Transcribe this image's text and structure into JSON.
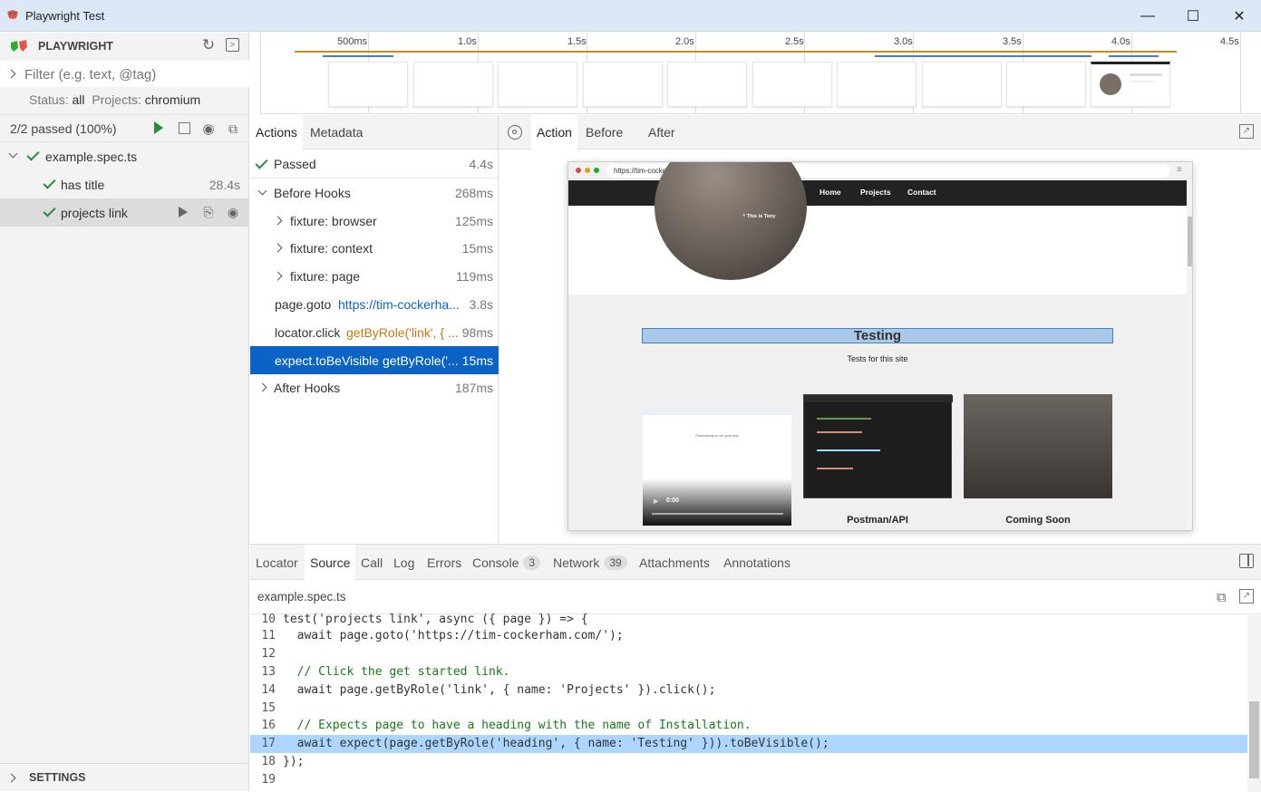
{
  "window": {
    "title": "Playwright Test",
    "minimize": "—",
    "maximize": "☐",
    "close": "✕"
  },
  "sidebar": {
    "brand": "PLAYWRIGHT",
    "filter_placeholder": "Filter (e.g. text, @tag)",
    "status_label": "Status:",
    "status_value": "all",
    "projects_label": "Projects:",
    "projects_value": "chromium",
    "summary": "2/2 passed (100%)",
    "file": "example.spec.ts",
    "tests": [
      {
        "name": "has title",
        "time": "28.4s"
      },
      {
        "name": "projects link"
      }
    ],
    "settings": "SETTINGS"
  },
  "timeline": {
    "ticks": [
      "500ms",
      "1.0s",
      "1.5s",
      "2.0s",
      "2.5s",
      "3.0s",
      "3.5s",
      "4.0s",
      "4.5s"
    ]
  },
  "actions_panel": {
    "tabs": [
      "Actions",
      "Metadata"
    ],
    "rows": [
      {
        "label": "Passed",
        "time": "4.4s"
      },
      {
        "label": "Before Hooks",
        "time": "268ms"
      },
      {
        "label": "fixture: browser",
        "time": "125ms"
      },
      {
        "label": "fixture: context",
        "time": "15ms"
      },
      {
        "label": "fixture: page",
        "time": "119ms"
      },
      {
        "label": "page.goto",
        "arg": "https://tim-cockerha...",
        "time": "3.8s"
      },
      {
        "label": "locator.click",
        "arg": "getByRole('link', { ...",
        "time": "98ms"
      },
      {
        "label": "expect.toBeVisible",
        "arg": "getByRole('...",
        "time": "15ms"
      },
      {
        "label": "After Hooks",
        "time": "187ms"
      }
    ]
  },
  "preview": {
    "tabs": [
      "Action",
      "Before",
      "After"
    ],
    "url": "https://tim-cockerham.com/",
    "nav": [
      "Home",
      "Projects",
      "Contact"
    ],
    "caption": "^ This is Tony",
    "heading": "Testing",
    "subheading": "Tests for this site",
    "video_time": "0:00",
    "video_text": "Processing to run your test",
    "cards": [
      "Postman/API",
      "Coming Soon"
    ]
  },
  "bottom": {
    "tabs": [
      "Locator",
      "Source",
      "Call",
      "Log",
      "Errors",
      "Console",
      "Network",
      "Attachments",
      "Annotations"
    ],
    "console_count": "3",
    "network_count": "39",
    "filename": "example.spec.ts",
    "code": [
      {
        "n": "10",
        "text": "test('projects link', async ({ page }) => {"
      },
      {
        "n": "11",
        "text": "  await page.goto('https://tim-cockerham.com/');"
      },
      {
        "n": "12",
        "text": ""
      },
      {
        "n": "13",
        "text": "  // Click the get started link."
      },
      {
        "n": "14",
        "text": "  await page.getByRole('link', { name: 'Projects' }).click();"
      },
      {
        "n": "15",
        "text": ""
      },
      {
        "n": "16",
        "text": "  // Expects page to have a heading with the name of Installation."
      },
      {
        "n": "17",
        "text": "  await expect(page.getByRole('heading', { name: 'Testing' })).toBeVisible();"
      },
      {
        "n": "18",
        "text": "});"
      },
      {
        "n": "19",
        "text": ""
      }
    ]
  },
  "colors": {
    "accent": "#0b63c6",
    "selected_row": "#0b63c6",
    "highlight_line": "#add6ff",
    "passed": "#2a8c3a"
  }
}
